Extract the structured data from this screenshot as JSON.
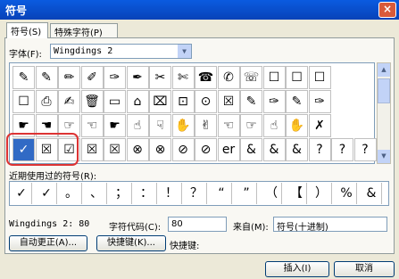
{
  "window": {
    "title": "符号",
    "close": "×"
  },
  "tabs": [
    {
      "label": "符号(S)"
    },
    {
      "label": "特殊字符(P)"
    }
  ],
  "font": {
    "label": "字体(F):",
    "value": "Wingdings 2",
    "arrow": "▼"
  },
  "symbols": [
    [
      "✎",
      "✎",
      "✏",
      "✐",
      "✑",
      "✒",
      "✂",
      "✄",
      "☎",
      "✆",
      "☏",
      "☐",
      "☐",
      "☐"
    ],
    [
      "☐",
      "⎙",
      "✍",
      "🗑",
      "▭",
      "⌂",
      "⌧",
      "⊡",
      "⊙",
      "☒",
      "✎",
      "✑",
      "✎",
      "✑"
    ],
    [
      "☛",
      "☚",
      "☞",
      "☜",
      "☛",
      "☝",
      "☟",
      "✋",
      "✌",
      "☜",
      "☞",
      "☝",
      "✋",
      "✗"
    ],
    [
      "✓",
      "☒",
      "☑",
      "☒",
      "☒",
      "⊗",
      "⊗",
      "⊘",
      "⊘",
      "er",
      "&",
      "&",
      "&",
      "?",
      "?",
      "?"
    ]
  ],
  "recent": {
    "label": "近期使用过的符号(R):",
    "items": [
      "✓",
      "✓",
      "。",
      "、",
      "；",
      "：",
      "！",
      "？",
      "“",
      "”",
      "（",
      "【",
      "）",
      "%",
      "&"
    ]
  },
  "info": {
    "font_code_text": "Wingdings 2: 80",
    "code_label": "字符代码(C):",
    "code_value": "80",
    "from_label": "来自(M):",
    "from_value": "符号(十进制)"
  },
  "buttons": {
    "autocorrect": "自动更正(A)...",
    "shortcut": "快捷键(K)...",
    "shortcut_label": "快捷键:",
    "insert": "插入(I)",
    "cancel": "取消"
  },
  "scroll": {
    "up": "▲",
    "down": "▼"
  }
}
